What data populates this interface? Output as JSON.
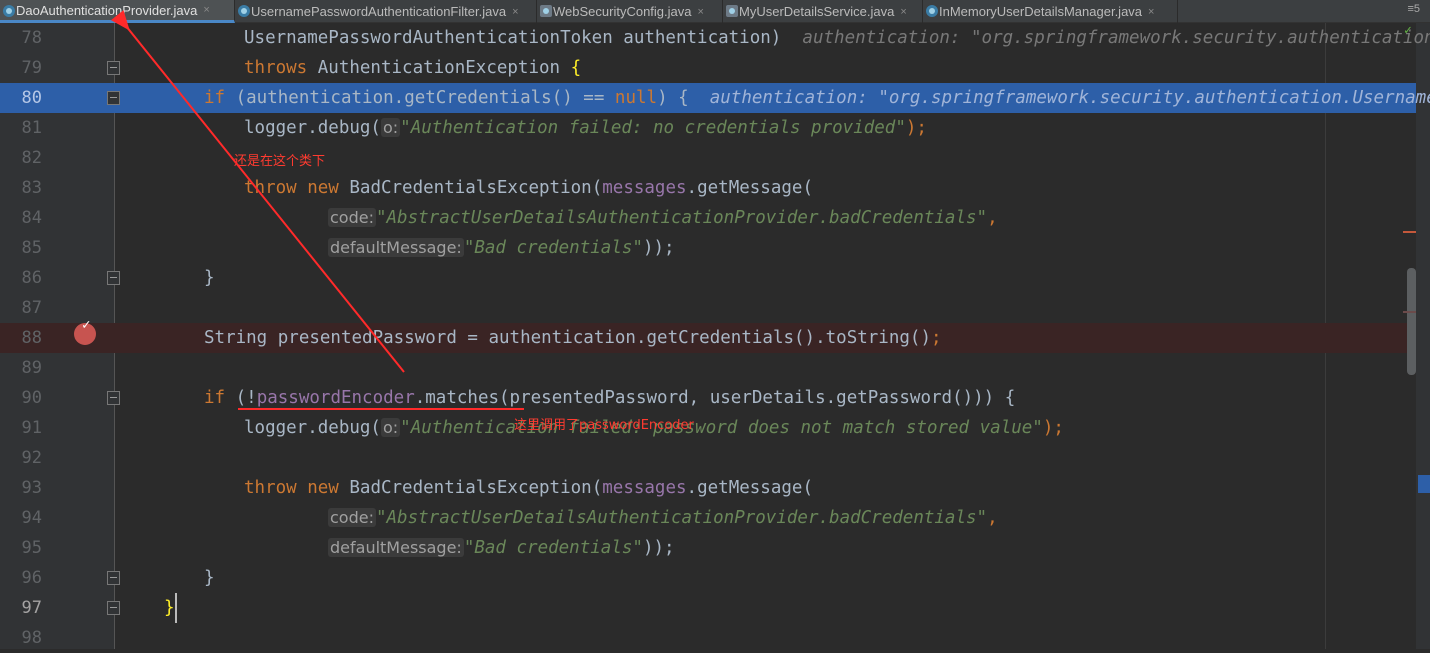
{
  "tabs": [
    {
      "label": "DaoAuthenticationProvider.java",
      "active": true
    },
    {
      "label": "UsernamePasswordAuthenticationFilter.java",
      "active": false
    },
    {
      "label": "WebSecurityConfig.java",
      "active": false
    },
    {
      "label": "MyUserDetailsService.java",
      "active": false
    },
    {
      "label": "InMemoryUserDetailsManager.java",
      "active": false
    }
  ],
  "tab_close_glyph": "×",
  "tab_menu_label": "≡5",
  "line_numbers": [
    "78",
    "79",
    "80",
    "81",
    "82",
    "83",
    "84",
    "85",
    "86",
    "87",
    "88",
    "89",
    "90",
    "91",
    "92",
    "93",
    "94",
    "95",
    "96",
    "97",
    "98"
  ],
  "code": {
    "l78_a": "UsernamePasswordAuthenticationToken authentication)",
    "l78_hint": "authentication: \"org.springframework.security.authentication.Use",
    "l79_kw": "throws",
    "l79_a": " AuthenticationException ",
    "l79_brace": "{",
    "l80_kw1": "if",
    "l80_a": " (authentication.getCredentials() == ",
    "l80_kw2": "null",
    "l80_b": ") {",
    "l80_hint": "authentication: \"org.springframework.security.authentication.UsernamePass",
    "l81_a": "logger.debug(",
    "l81_param": "o:",
    "l81_str": "\"Authentication failed: no credentials provided\"",
    "l81_b": ");",
    "l83_kw1": "throw",
    "l83_kw2": "new",
    "l83_a": " BadCredentialsException(",
    "l83_field": "messages",
    "l83_b": ".getMessage(",
    "l84_param": "code:",
    "l84_str": "\"AbstractUserDetailsAuthenticationProvider.badCredentials\"",
    "l84_b": ",",
    "l85_param": "defaultMessage:",
    "l85_str": "\"Bad credentials\"",
    "l85_b": "));",
    "l86_a": "}",
    "l88_a": "String presentedPassword = authentication.getCredentials().toString()",
    "l88_b": ";",
    "l90_kw": "if",
    "l90_a": " (!",
    "l90_field": "passwordEncoder",
    "l90_b": ".matches(presentedPassword, userDetails.getPassword())) {",
    "l91_a": "logger.debug(",
    "l91_param": "o:",
    "l91_str": "\"Authentication failed: password does not match stored value\"",
    "l91_b": ");",
    "l93_kw1": "throw",
    "l93_kw2": "new",
    "l93_a": " BadCredentialsException(",
    "l93_field": "messages",
    "l93_b": ".getMessage(",
    "l94_param": "code:",
    "l94_str": "\"AbstractUserDetailsAuthenticationProvider.badCredentials\"",
    "l94_b": ",",
    "l95_param": "defaultMessage:",
    "l95_str": "\"Bad credentials\"",
    "l95_b": "));",
    "l96_a": "}",
    "l97_a": "}"
  },
  "annotations": {
    "class_note": "还是在这个类下",
    "encoder_note": "这里调用了passwordEncoder"
  },
  "breakpoint_line": "88",
  "execution_line": "80",
  "colors": {
    "background": "#2b2b2b",
    "execution_highlight": "#2d5fa8",
    "breakpoint": "#c75450",
    "annotation": "#ff3b30"
  }
}
